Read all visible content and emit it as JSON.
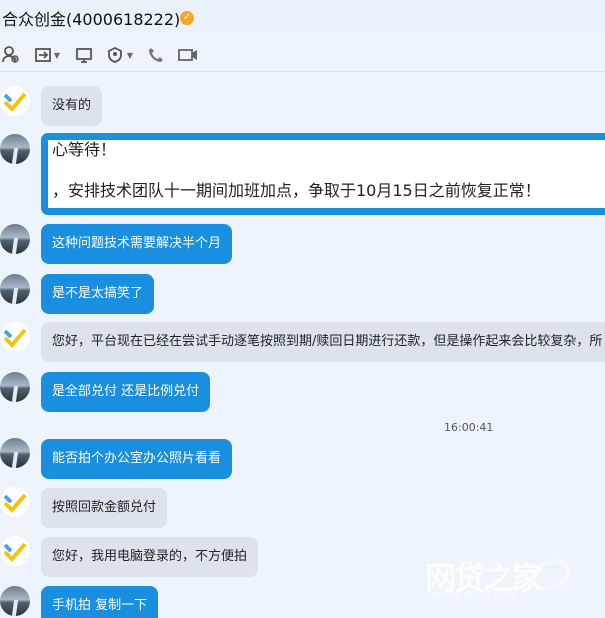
{
  "window": {
    "title": "合众创金(4000618222)",
    "verified_badge": "✓",
    "colors": {
      "blue_bubble": "#1a8fe0",
      "gray_bubble": "#dde3ea",
      "background": "#edf4fc",
      "badge": "#f5a623"
    }
  },
  "toolbar": {
    "icons": [
      "add-contact-icon",
      "transfer-icon",
      "screen-share-icon",
      "group-icon",
      "phone-icon",
      "video-icon"
    ],
    "dropdown_glyph": "▼"
  },
  "messages": [
    {
      "text": "没有的",
      "style": "gray"
    },
    {
      "line1": "心等待！",
      "line2": "，安排技术团队十一期间加班加点，争取于10月15日之前恢复正常！"
    },
    {
      "text": "这种问题技术需要解决半个月",
      "style": "blue"
    },
    {
      "text": "是不是太搞笑了",
      "style": "blue"
    },
    {
      "text": "您好，平台现在已经在尝试手动逐笔按照到期/赎回日期进行还款，但是操作起来会比较复杂，所",
      "style": "gray"
    },
    {
      "text": "是全部兑付 还是比例兑付",
      "style": "blue"
    },
    {
      "text": "能否拍个办公室办公照片看看",
      "style": "blue"
    },
    {
      "text": "按照回款金额兑付",
      "style": "gray"
    },
    {
      "text": "您好，我用电脑登录的，不方便拍",
      "style": "gray"
    },
    {
      "text": "手机拍 复制一下",
      "style": "blue"
    }
  ],
  "timestamp": "16:00:41",
  "watermark": {
    "main": "网贷之家",
    "sub": "WWW.WDZJ.COM"
  }
}
